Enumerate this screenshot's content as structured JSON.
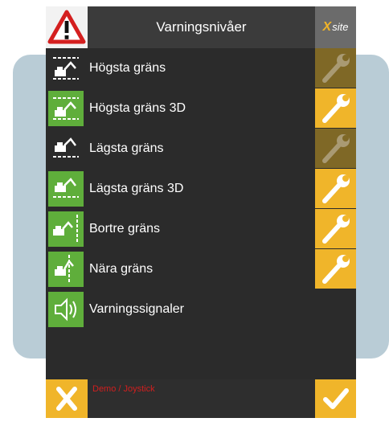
{
  "header": {
    "title": "Varningsnivåer",
    "brand": "site",
    "brand_mark": "X",
    "warning_icon": "warning-triangle-icon"
  },
  "rows": [
    {
      "label": "Högsta gräns",
      "icon": "upper-limit-icon",
      "icon_active": false,
      "tool_state": "disabled"
    },
    {
      "label": "Högsta gräns 3D",
      "icon": "upper-limit-3d-icon",
      "icon_active": true,
      "tool_state": "enabled"
    },
    {
      "label": "Lägsta gräns",
      "icon": "lower-limit-icon",
      "icon_active": false,
      "tool_state": "disabled"
    },
    {
      "label": "Lägsta gräns 3D",
      "icon": "lower-limit-3d-icon",
      "icon_active": true,
      "tool_state": "enabled"
    },
    {
      "label": "Bortre gräns",
      "icon": "far-limit-icon",
      "icon_active": true,
      "tool_state": "enabled"
    },
    {
      "label": "Nära gräns",
      "icon": "near-limit-icon",
      "icon_active": true,
      "tool_state": "enabled"
    },
    {
      "label": "Varningssignaler",
      "icon": "speaker-icon",
      "icon_active": true,
      "tool_state": "none"
    }
  ],
  "footer": {
    "mode_text": "Demo / Joystick",
    "cancel_icon": "close-icon",
    "confirm_icon": "checkmark-icon"
  },
  "colors": {
    "accent": "#f0b52a",
    "accent_dim": "#7f6826",
    "active_icon": "#5fae3b",
    "panel": "#2b2b2b",
    "mode_text": "#d11f1f"
  }
}
